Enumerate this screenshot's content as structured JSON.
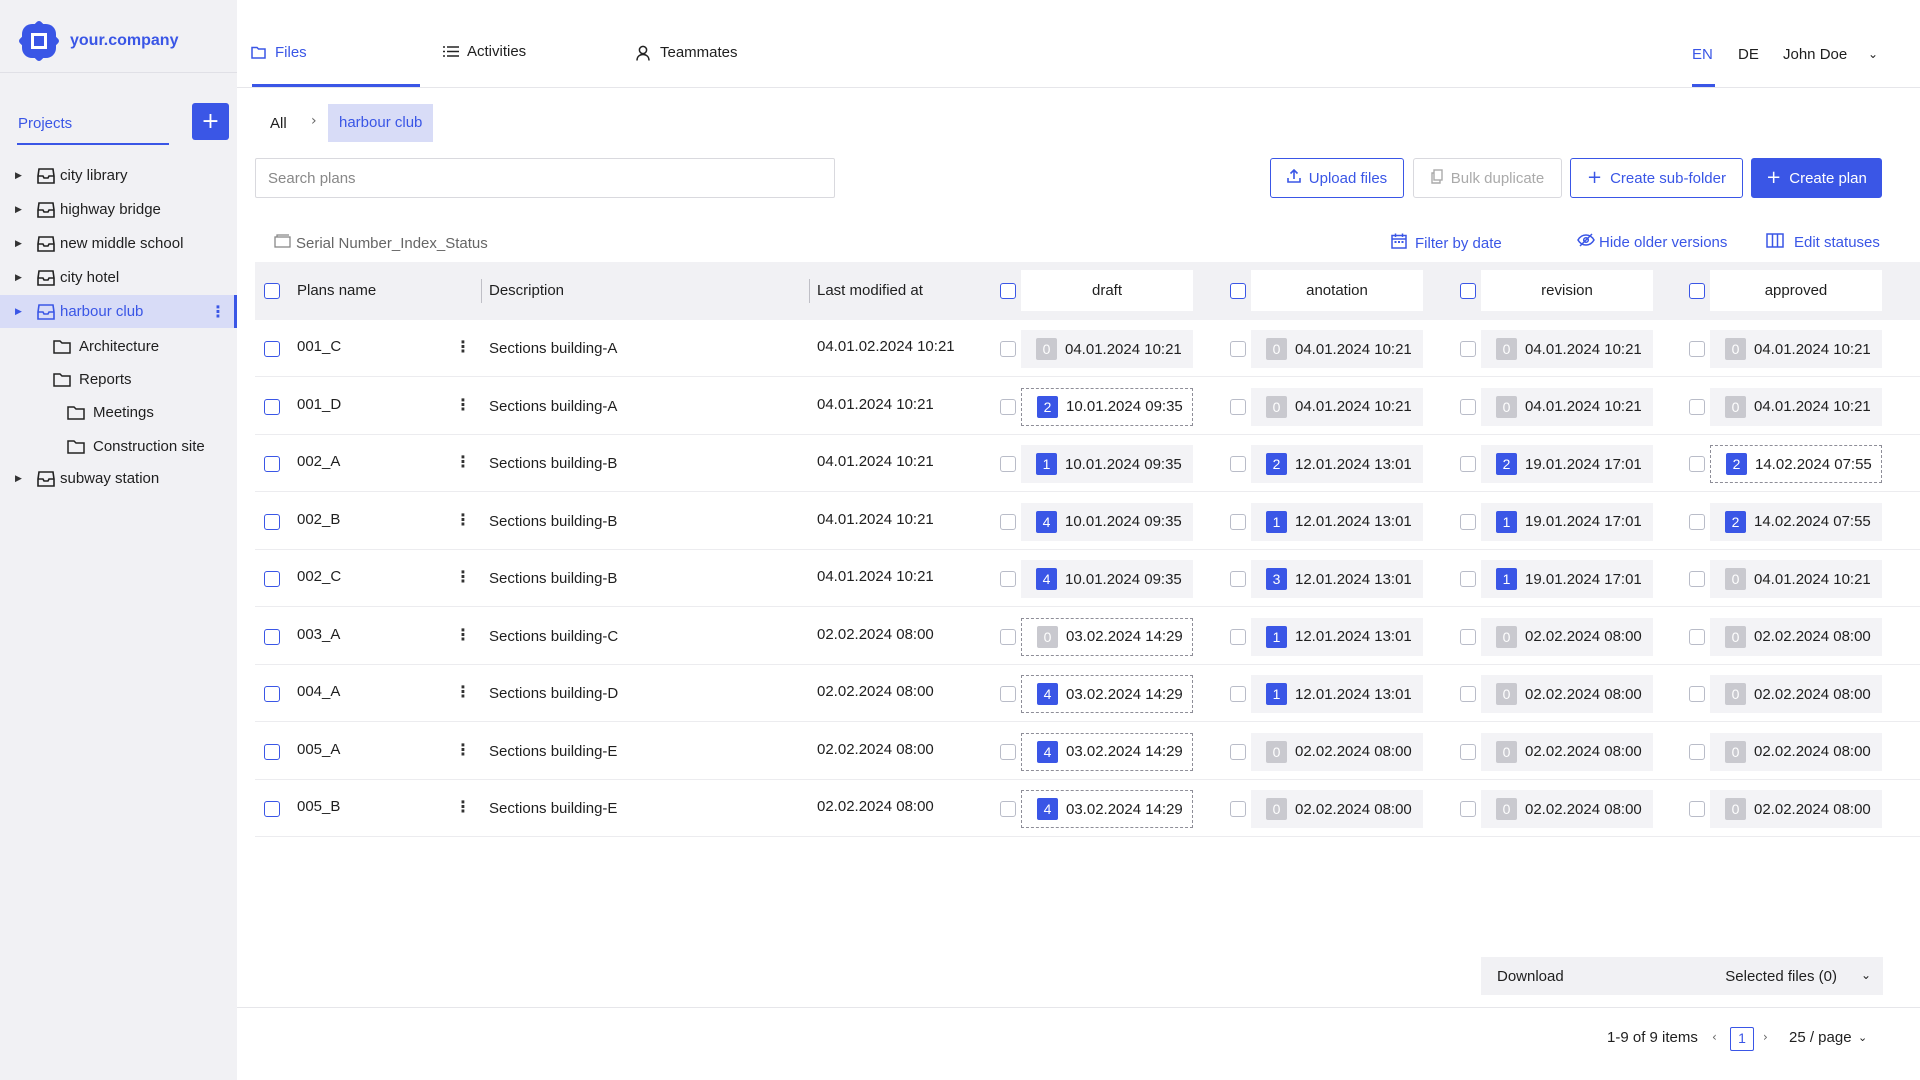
{
  "app": {
    "logo_text": "your.company"
  },
  "sidebar": {
    "projects_label": "Projects",
    "add_label": "+",
    "projects": [
      {
        "label": "city library"
      },
      {
        "label": "highway bridge"
      },
      {
        "label": "new middle school"
      },
      {
        "label": "city hotel"
      },
      {
        "label": "harbour club",
        "active": true
      },
      {
        "label": "subway station"
      }
    ],
    "folders": [
      {
        "label": "Architecture"
      },
      {
        "label": "Reports"
      },
      {
        "label": "Meetings"
      },
      {
        "label": "Construction site"
      }
    ]
  },
  "nav": {
    "tabs": [
      {
        "label": "Files",
        "active": true
      },
      {
        "label": "Activities"
      },
      {
        "label": "Teammates"
      }
    ],
    "lang_en": "EN",
    "lang_de": "DE",
    "user": "John  Doe"
  },
  "breadcrumb": {
    "all": "All",
    "current": "harbour club"
  },
  "search": {
    "placeholder": "Search plans"
  },
  "actions": {
    "upload": "Upload files",
    "bulk_duplicate": "Bulk duplicate",
    "create_subfolder": "Create sub-folder",
    "create_plan": "Create plan"
  },
  "toolbar": {
    "serial": "Serial Number_Index_Status",
    "filter_by_date": "Filter by date",
    "hide_older": "Hide older versions",
    "edit_statuses": "Edit statuses"
  },
  "table": {
    "headers": {
      "plans_name": "Plans name",
      "description": "Description",
      "last_modified": "Last modified at"
    },
    "status_columns": [
      "draft",
      "anotation",
      "revision",
      "approved"
    ],
    "rows": [
      {
        "name": "001_C",
        "description": "Sections building-A",
        "modified": "04.01.02.2024 10:21",
        "statuses": [
          {
            "count": "0",
            "date": "04.01.2024 10:21"
          },
          {
            "count": "0",
            "date": "04.01.2024 10:21"
          },
          {
            "count": "0",
            "date": "04.01.2024 10:21"
          },
          {
            "count": "0",
            "date": "04.01.2024 10:21"
          }
        ]
      },
      {
        "name": "001_D",
        "description": "Sections building-A",
        "modified": "04.01.2024 10:21",
        "statuses": [
          {
            "count": "2",
            "date": "10.01.2024 09:35",
            "current": true
          },
          {
            "count": "0",
            "date": "04.01.2024 10:21"
          },
          {
            "count": "0",
            "date": "04.01.2024 10:21"
          },
          {
            "count": "0",
            "date": "04.01.2024 10:21"
          }
        ]
      },
      {
        "name": "002_A",
        "description": "Sections building-B",
        "modified": "04.01.2024 10:21",
        "statuses": [
          {
            "count": "1",
            "date": "10.01.2024 09:35"
          },
          {
            "count": "2",
            "date": "12.01.2024 13:01"
          },
          {
            "count": "2",
            "date": "19.01.2024 17:01"
          },
          {
            "count": "2",
            "date": "14.02.2024 07:55",
            "current": true
          }
        ]
      },
      {
        "name": "002_B",
        "description": "Sections building-B",
        "modified": "04.01.2024 10:21",
        "statuses": [
          {
            "count": "4",
            "date": "10.01.2024 09:35"
          },
          {
            "count": "1",
            "date": "12.01.2024 13:01"
          },
          {
            "count": "1",
            "date": "19.01.2024 17:01"
          },
          {
            "count": "2",
            "date": "14.02.2024 07:55"
          }
        ]
      },
      {
        "name": "002_C",
        "description": "Sections building-B",
        "modified": "04.01.2024 10:21",
        "statuses": [
          {
            "count": "4",
            "date": "10.01.2024 09:35"
          },
          {
            "count": "3",
            "date": "12.01.2024 13:01"
          },
          {
            "count": "1",
            "date": "19.01.2024 17:01"
          },
          {
            "count": "0",
            "date": "04.01.2024 10:21"
          }
        ]
      },
      {
        "name": "003_A",
        "description": "Sections building-C",
        "modified": "02.02.2024 08:00",
        "statuses": [
          {
            "count": "0",
            "date": "03.02.2024 14:29",
            "current": true
          },
          {
            "count": "1",
            "date": "12.01.2024 13:01"
          },
          {
            "count": "0",
            "date": "02.02.2024 08:00"
          },
          {
            "count": "0",
            "date": "02.02.2024 08:00"
          }
        ]
      },
      {
        "name": "004_A",
        "description": "Sections building-D",
        "modified": "02.02.2024 08:00",
        "statuses": [
          {
            "count": "4",
            "date": "03.02.2024 14:29",
            "current": true
          },
          {
            "count": "1",
            "date": "12.01.2024 13:01"
          },
          {
            "count": "0",
            "date": "02.02.2024 08:00"
          },
          {
            "count": "0",
            "date": "02.02.2024 08:00"
          }
        ]
      },
      {
        "name": "005_A",
        "description": "Sections building-E",
        "modified": "02.02.2024 08:00",
        "statuses": [
          {
            "count": "4",
            "date": "03.02.2024 14:29",
            "current": true
          },
          {
            "count": "0",
            "date": "02.02.2024 08:00"
          },
          {
            "count": "0",
            "date": "02.02.2024 08:00"
          },
          {
            "count": "0",
            "date": "02.02.2024 08:00"
          }
        ]
      },
      {
        "name": "005_B",
        "description": "Sections building-E",
        "modified": "02.02.2024 08:00",
        "statuses": [
          {
            "count": "4",
            "date": "03.02.2024 14:29",
            "current": true
          },
          {
            "count": "0",
            "date": "02.02.2024 08:00"
          },
          {
            "count": "0",
            "date": "02.02.2024 08:00"
          },
          {
            "count": "0",
            "date": "02.02.2024 08:00"
          }
        ]
      }
    ]
  },
  "footer": {
    "download": "Download",
    "selected_files": "Selected files (0)",
    "pagination_info": "1-9 of 9 items",
    "current_page": "1",
    "page_size": "25 / page"
  },
  "colors": {
    "accent": "#3a56e6",
    "sidebar_bg": "#f1f1f4",
    "active_bg": "#d8dcf7"
  }
}
